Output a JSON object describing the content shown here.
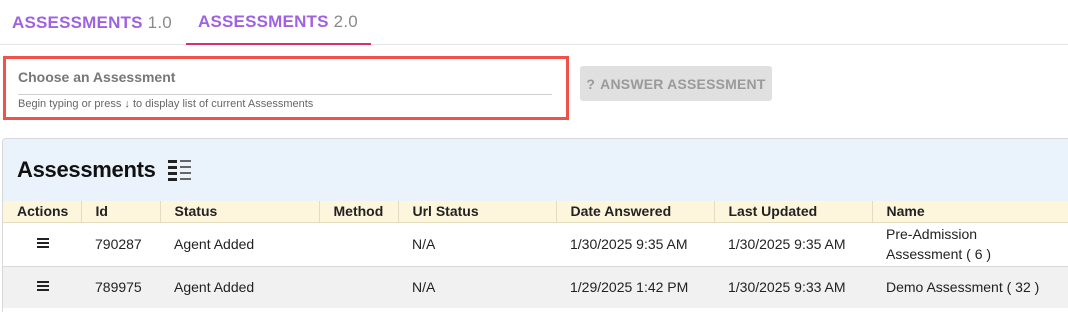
{
  "tabs": [
    {
      "strong": "ASSESSMENTS",
      "version": "1.0"
    },
    {
      "strong": "ASSESSMENTS",
      "version": "2.0",
      "active": true
    }
  ],
  "chooser": {
    "label": "Choose an Assessment",
    "hint": "Begin typing or press ↓ to display list of current Assessments"
  },
  "answer_button": {
    "icon": "?",
    "label": "ANSWER ASSESSMENT"
  },
  "panel": {
    "title": "Assessments",
    "columns": [
      "Actions",
      "Id",
      "Status",
      "Method",
      "Url Status",
      "Date Answered",
      "Last Updated",
      "Name"
    ],
    "rows": [
      {
        "id": "790287",
        "status": "Agent Added",
        "method": "",
        "url_status": "N/A",
        "date_answered": "1/30/2025 9:35 AM",
        "last_updated": "1/30/2025 9:35 AM",
        "name": "Pre-Admission Assessment ( 6 )"
      },
      {
        "id": "789975",
        "status": "Agent Added",
        "method": "",
        "url_status": "N/A",
        "date_answered": "1/29/2025 1:42 PM",
        "last_updated": "1/30/2025 9:33 AM",
        "name": "Demo Assessment ( 32 )"
      }
    ]
  },
  "colors": {
    "tab_purple": "#a062e0",
    "tab_underline": "#d6336c",
    "highlight_border": "#f0524b",
    "panel_header_bg": "#eaf3fb",
    "table_header_bg": "#fdf6dc"
  }
}
